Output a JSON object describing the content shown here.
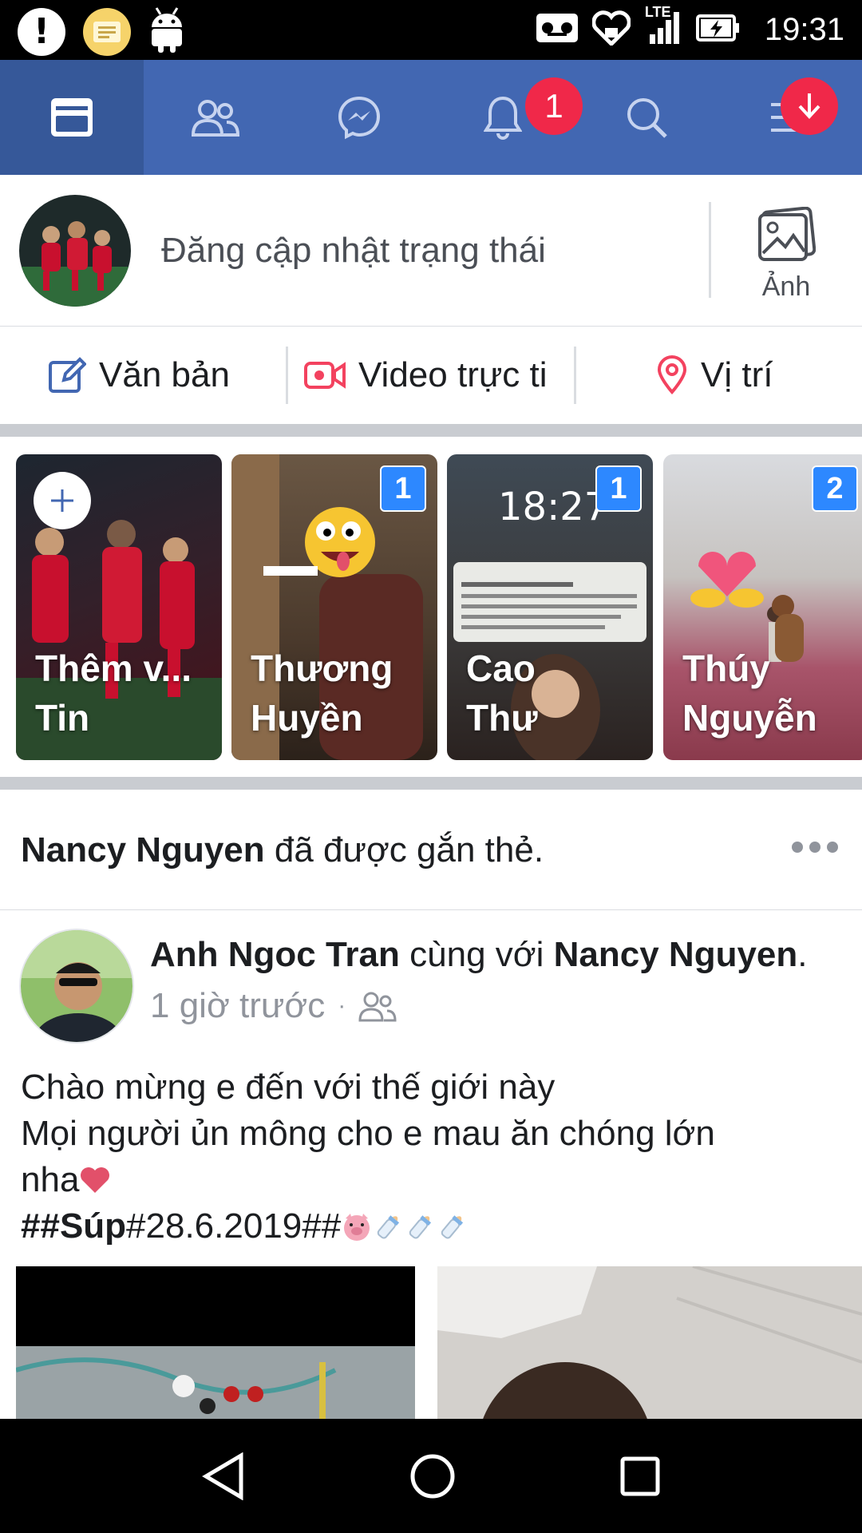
{
  "status_bar": {
    "time": "19:31",
    "network": "LTE",
    "icons": [
      "alert-icon",
      "note-icon",
      "android-icon",
      "voicemail-icon",
      "heart-icon",
      "signal-icon",
      "battery-charging-icon"
    ]
  },
  "top_nav": {
    "tabs": [
      {
        "name": "news-feed",
        "icon": "news-feed-icon",
        "active": true
      },
      {
        "name": "friends",
        "icon": "friends-icon"
      },
      {
        "name": "messenger",
        "icon": "messenger-icon"
      },
      {
        "name": "notifications",
        "icon": "bell-icon",
        "badge": "1"
      },
      {
        "name": "search",
        "icon": "search-icon"
      },
      {
        "name": "menu",
        "icon": "menu-icon"
      }
    ],
    "colors": {
      "bar": "#4267b2",
      "active": "#365899",
      "badge": "#f02849"
    }
  },
  "composer": {
    "prompt": "Đăng cập nhật trạng thái",
    "photo_label": "Ảnh"
  },
  "actions": [
    {
      "label": "Văn bản",
      "icon": "edit-icon"
    },
    {
      "label": "Video trực ti",
      "icon": "live-video-icon"
    },
    {
      "label": "Vị trí",
      "icon": "location-pin-icon"
    }
  ],
  "stories": [
    {
      "name_line1": "Thêm v...",
      "name_line2": "Tin",
      "add": true
    },
    {
      "name_line1": "Thương",
      "name_line2": "Huyền",
      "count": "1"
    },
    {
      "name_line1": "Cao",
      "name_line2": "Thư",
      "count": "1"
    },
    {
      "name_line1": "Thúy",
      "name_line2": "Nguyễn",
      "count": "2"
    }
  ],
  "tag_notice": {
    "name": "Nancy Nguyen",
    "text": " đã được gắn thẻ."
  },
  "post": {
    "author": "Anh Ngoc Tran",
    "with_text": " cùng với ",
    "tagged": "Nancy Nguyen",
    "period": ".",
    "time": "1 giờ trước",
    "separator": "·",
    "audience_icon": "friends-audience-icon",
    "body_line1": "Chào mừng e đến với thế giới này",
    "body_line2": "Mọi người ủn mông cho e mau ăn chóng lớn",
    "body_line3": "nha",
    "body_line4_bold": "##Súp",
    "body_line4_rest": "#28.6.2019##",
    "emojis": [
      "heart-emoji",
      "pig-emoji",
      "baby-bottle-emoji",
      "baby-bottle-emoji",
      "baby-bottle-emoji"
    ]
  },
  "android_nav": [
    "back-icon",
    "home-icon",
    "recents-icon"
  ]
}
